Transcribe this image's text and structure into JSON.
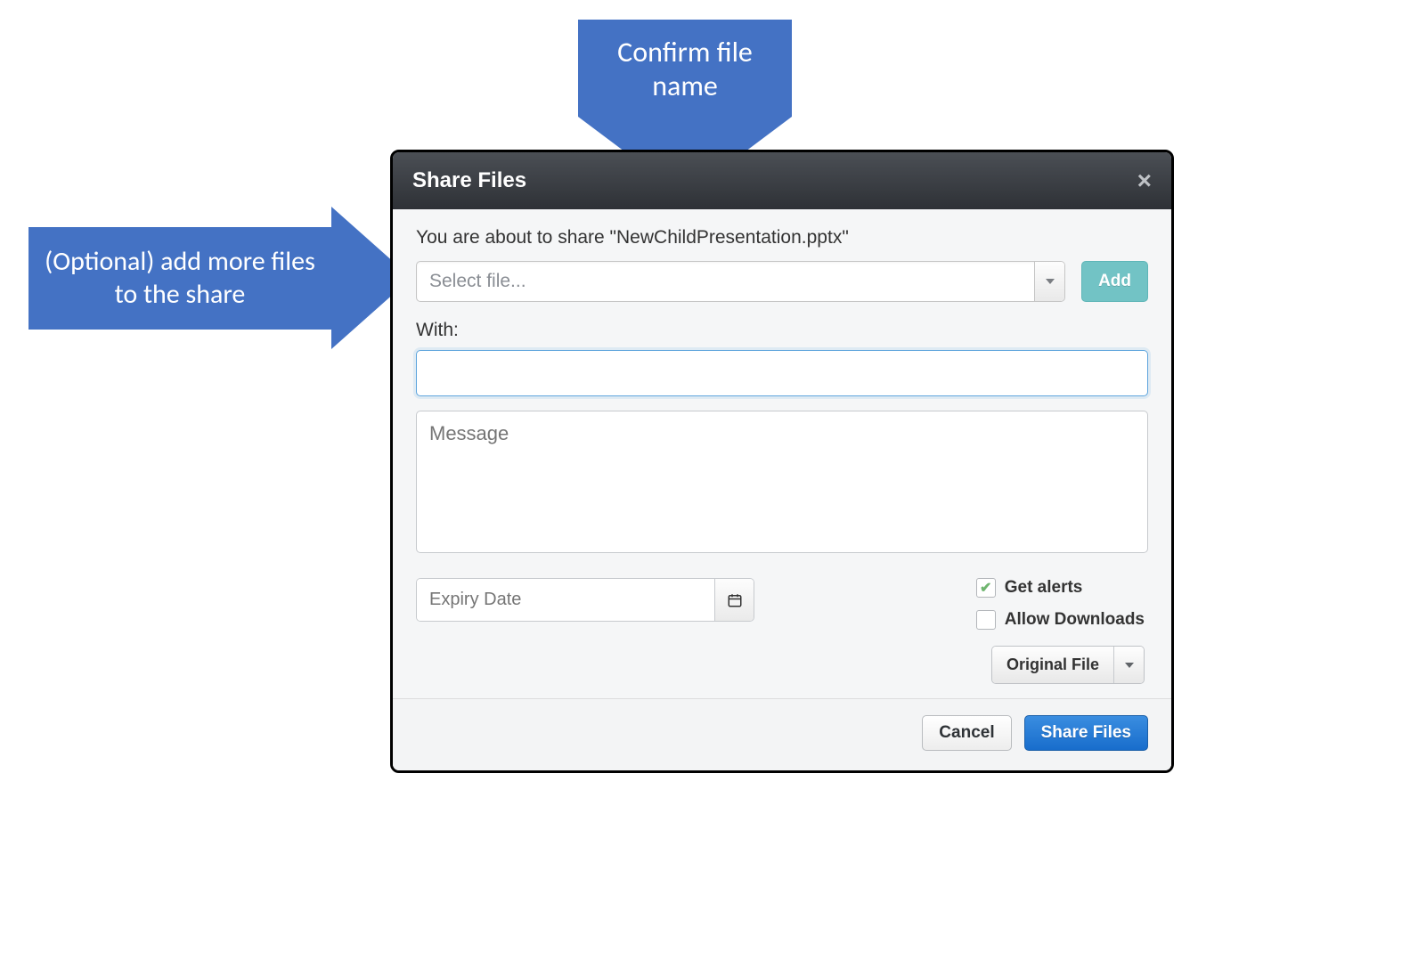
{
  "annotations": {
    "top": "Confirm file name",
    "left": "(Optional) add more files to the share"
  },
  "dialog": {
    "title": "Share Files",
    "confirm_prefix": "You are about to share \"",
    "file_name": "NewChildPresentation.pptx",
    "confirm_suffix": "\"",
    "file_select_placeholder": "Select file...",
    "add_button": "Add",
    "with_label": "With:",
    "with_value": "",
    "message_placeholder": "Message",
    "expiry_placeholder": "Expiry Date",
    "get_alerts_label": "Get alerts",
    "get_alerts_checked": true,
    "allow_downloads_label": "Allow Downloads",
    "allow_downloads_checked": false,
    "download_type": "Original File",
    "cancel": "Cancel",
    "submit": "Share Files"
  }
}
